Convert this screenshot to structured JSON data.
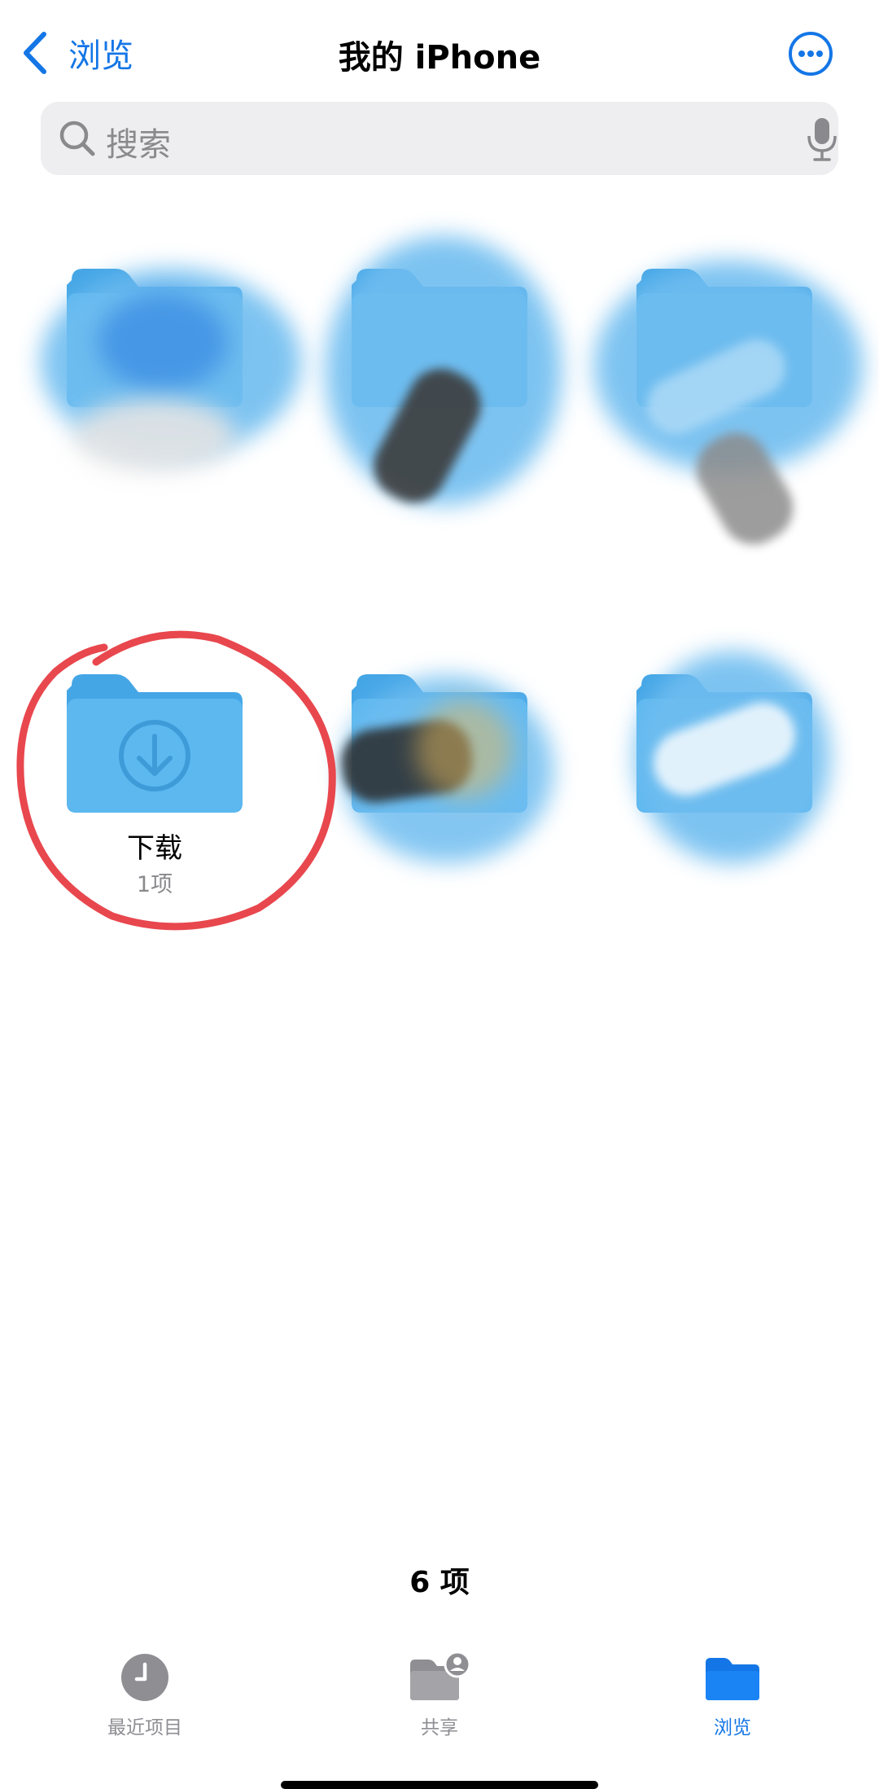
{
  "nav": {
    "back_label": "浏览",
    "title": "我的 iPhone"
  },
  "search": {
    "placeholder": "搜索"
  },
  "folders": [
    {
      "name": "",
      "count": ""
    },
    {
      "name": "",
      "count": ""
    },
    {
      "name": "",
      "count": ""
    },
    {
      "name": "下载",
      "count": "1项",
      "icon": "download-icon"
    },
    {
      "name": "",
      "count": ""
    },
    {
      "name": "",
      "count": ""
    }
  ],
  "footer": {
    "item_count": "6 项"
  },
  "tabs": [
    {
      "label": "最近项目",
      "icon": "clock-icon",
      "active": false
    },
    {
      "label": "共享",
      "icon": "shared-folder-icon",
      "active": false
    },
    {
      "label": "浏览",
      "icon": "folder-icon",
      "active": true
    }
  ],
  "colors": {
    "accent": "#1476e6",
    "folder": "#5cb8ef",
    "folder_tab": "#45a6e6",
    "annotation": "#e8474e"
  }
}
